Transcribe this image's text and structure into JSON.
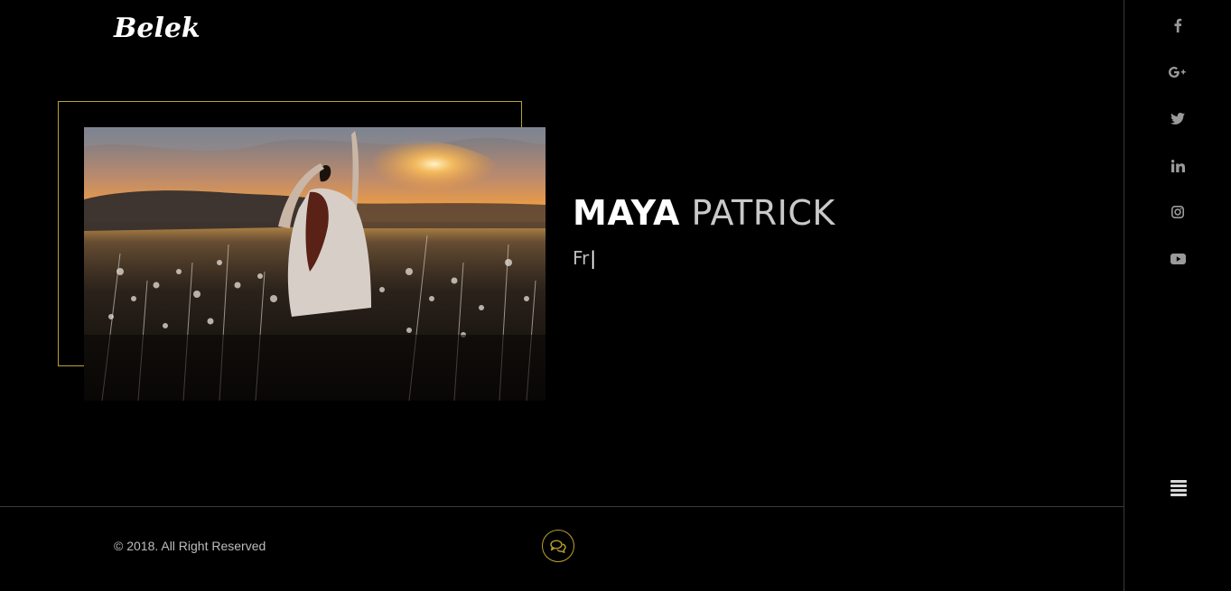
{
  "brand": {
    "logo_text": "Belek"
  },
  "hero": {
    "first_name": "MAYA",
    "last_name": "PATRICK",
    "typed_text": "Fr",
    "accent_color": "#b9a22e"
  },
  "social": [
    {
      "name": "facebook",
      "label": "f"
    },
    {
      "name": "google-plus",
      "label": "G+"
    },
    {
      "name": "twitter",
      "label": ""
    },
    {
      "name": "linkedin",
      "label": "in"
    },
    {
      "name": "instagram",
      "label": ""
    },
    {
      "name": "youtube",
      "label": ""
    }
  ],
  "footer": {
    "copyright": "© 2018. All Right Reserved"
  }
}
